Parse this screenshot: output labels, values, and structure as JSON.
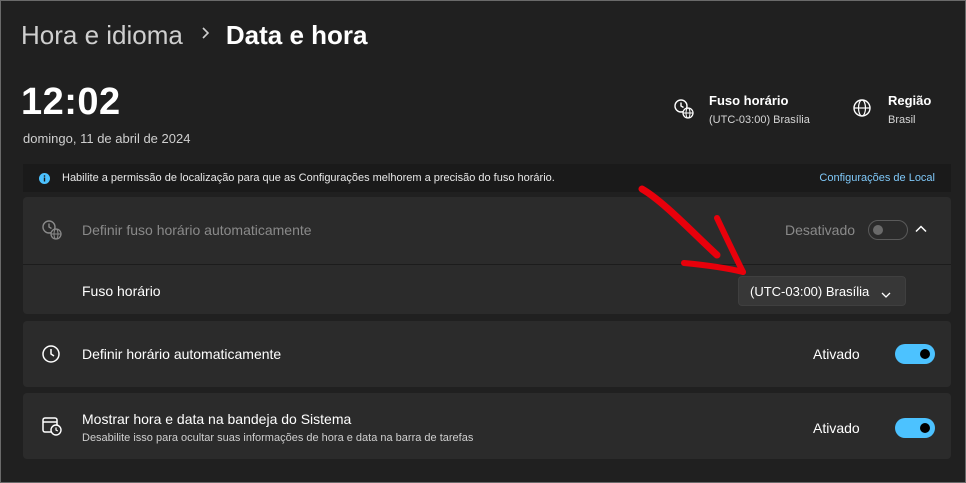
{
  "breadcrumb": {
    "parent": "Hora e idioma",
    "separator_icon": "chevron-right-icon",
    "current": "Data e hora"
  },
  "clock": {
    "time": "12:02",
    "date": "domingo, 11 de abril de 2024"
  },
  "timezone_info": {
    "icon": "globe-clock-icon",
    "title": "Fuso horário",
    "value": "(UTC-03:00) Brasília"
  },
  "region_info": {
    "icon": "globe-icon",
    "title": "Região",
    "value": "Brasil"
  },
  "location_banner": {
    "icon": "info-icon",
    "text": "Habilite a permissão de localização para que as Configurações melhorem a precisão do fuso horário.",
    "link": "Configurações de Local"
  },
  "auto_timezone": {
    "icon": "globe-clock-icon",
    "label": "Definir fuso horário automaticamente",
    "state": "Desativado",
    "enabled": false
  },
  "timezone_select": {
    "label": "Fuso horário",
    "value": "(UTC-03:00) Brasília"
  },
  "auto_time": {
    "icon": "clock-icon",
    "label": "Definir horário automaticamente",
    "state": "Ativado",
    "enabled": true
  },
  "tray": {
    "icon": "calendar-clock-icon",
    "label": "Mostrar hora e data na bandeja do Sistema",
    "description": "Desabilite isso para ocultar suas informações de hora e data na barra de tarefas",
    "state": "Ativado",
    "enabled": true
  },
  "colors": {
    "accent": "#4cc2ff",
    "link": "#7fc8f8",
    "annotation_arrow": "#e8000b",
    "background": "#202020",
    "card": "#2b2b2b"
  }
}
